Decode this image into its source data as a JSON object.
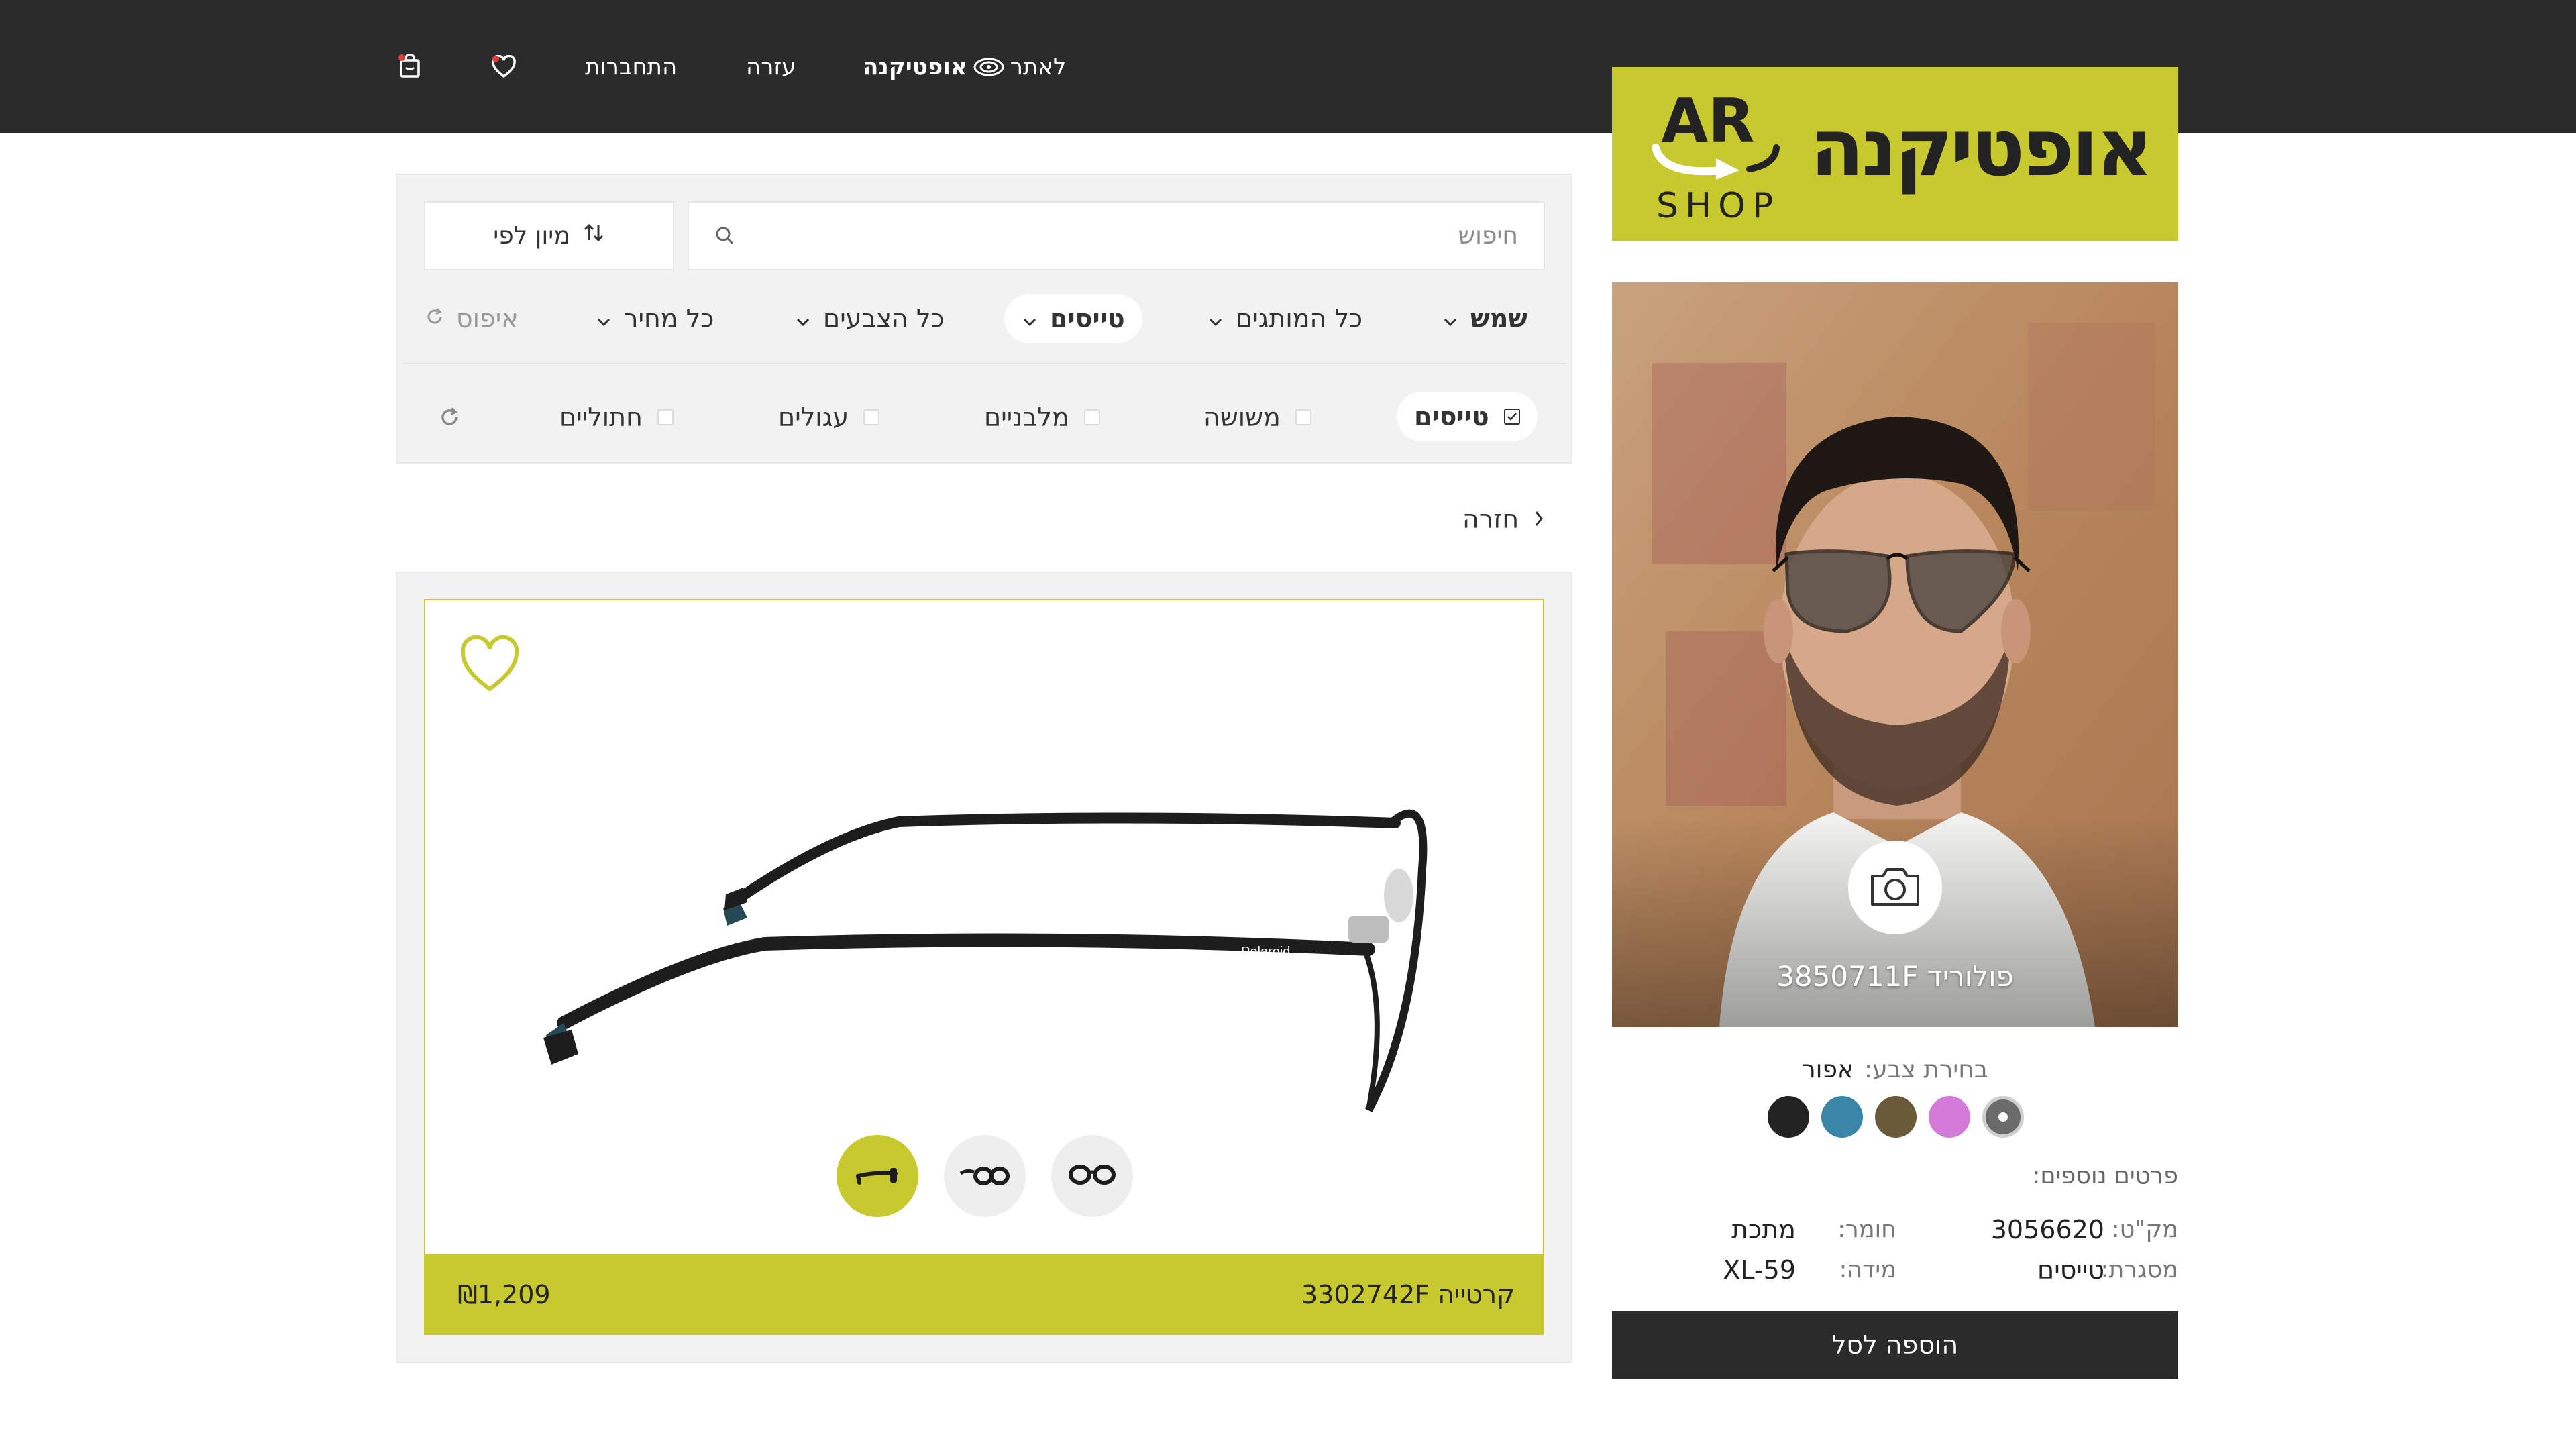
{
  "nav": {
    "site_link_prefix": "לאתר",
    "site_link_brand": "אופטיקנה",
    "help": "עזרה",
    "login": "התחברות"
  },
  "logo": {
    "brand_text": "אופטיקנה",
    "ar_text": "AR",
    "shop_text": "SHOP"
  },
  "search": {
    "placeholder": "חיפוש"
  },
  "sort": {
    "label": "מיון לפי"
  },
  "filters": {
    "category": "שמש",
    "brands": "כל המותגים",
    "type": "טייסים",
    "colors": "כל הצבעים",
    "price": "כל מחיר",
    "reset": "איפוס"
  },
  "shapes": [
    {
      "label": "טייסים",
      "checked": true
    },
    {
      "label": "משושה",
      "checked": false
    },
    {
      "label": "מלבניים",
      "checked": false
    },
    {
      "label": "עגולים",
      "checked": false
    },
    {
      "label": "חתוליים",
      "checked": false
    }
  ],
  "back": {
    "label": "חזרה"
  },
  "product": {
    "name": "קרטייה 3302742F",
    "price": "₪1,209",
    "frame_brand_print": "Polaroid",
    "view_buttons": [
      "side",
      "angle",
      "front"
    ],
    "active_view": "side"
  },
  "tryon": {
    "label": "פולוריד 3850711F"
  },
  "color_select": {
    "label": "בחירת צבע:",
    "selected": "אפור",
    "swatches": [
      {
        "name": "gray",
        "color": "#6b6b6b",
        "selected": true
      },
      {
        "name": "pink",
        "color": "#d47ad8",
        "selected": false
      },
      {
        "name": "brown",
        "color": "#6b5a3a",
        "selected": false
      },
      {
        "name": "teal",
        "color": "#3a86a8",
        "selected": false
      },
      {
        "name": "black",
        "color": "#222222",
        "selected": false
      }
    ]
  },
  "details": {
    "title": "פרטים נוספים:",
    "sku_label": "מק\"ט:",
    "sku_value": "3056620",
    "material_label": "חומר:",
    "material_value": "מתכת",
    "frame_label": "מסגרת:",
    "frame_value": "טייסים",
    "size_label": "מידה:",
    "size_value": "XL-59"
  },
  "cart": {
    "add_label": "הוספה לסל"
  },
  "colors": {
    "accent": "#c8c82f",
    "dark": "#2b2b2b"
  }
}
